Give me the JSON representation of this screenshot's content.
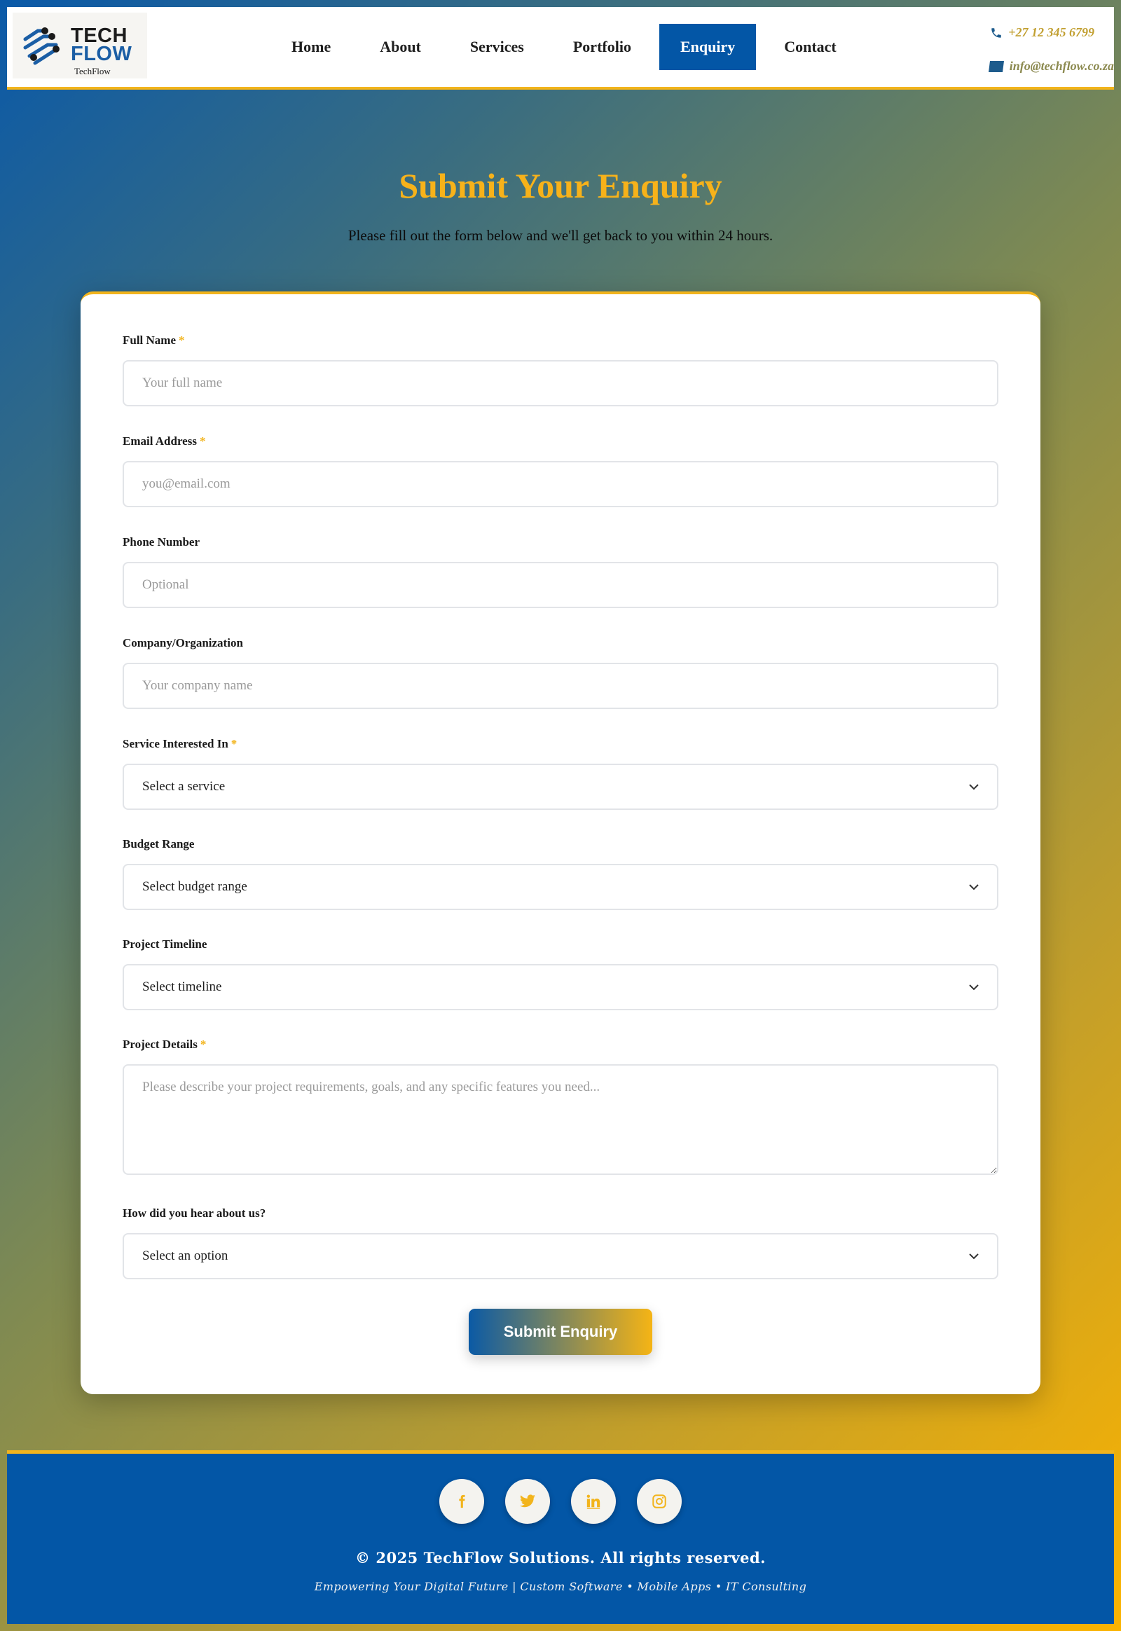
{
  "brand": {
    "logo_line1": "TECH",
    "logo_line2": "FLOW",
    "logo_sub": "TechFlow",
    "accent": "#f2b41c",
    "primary": "#0356a6"
  },
  "nav": {
    "items": [
      {
        "label": "Home",
        "active": false
      },
      {
        "label": "About",
        "active": false
      },
      {
        "label": "Services",
        "active": false
      },
      {
        "label": "Portfolio",
        "active": false
      },
      {
        "label": "Enquiry",
        "active": true
      },
      {
        "label": "Contact",
        "active": false
      }
    ]
  },
  "contact": {
    "phone": "+27 12 345 6799",
    "phone_icon": "phone-icon",
    "email": "info@techflow.co.za",
    "email_icon": "envelope-icon"
  },
  "hero": {
    "title": "Submit Your Enquiry",
    "subtitle": "Please fill out the form below and we'll get back to you within 24 hours."
  },
  "form": {
    "full_name": {
      "label": "Full Name",
      "required": "*",
      "placeholder": "Your full name",
      "value": ""
    },
    "email": {
      "label": "Email Address",
      "required": "*",
      "placeholder": "you@email.com",
      "value": ""
    },
    "phone": {
      "label": "Phone Number",
      "placeholder": "Optional",
      "value": ""
    },
    "company": {
      "label": "Company/Organization",
      "placeholder": "Your company name",
      "value": ""
    },
    "service": {
      "label": "Service Interested In",
      "required": "*",
      "selected": "Select a service"
    },
    "budget": {
      "label": "Budget Range",
      "selected": "Select budget range"
    },
    "timeline": {
      "label": "Project Timeline",
      "selected": "Select timeline"
    },
    "details": {
      "label": "Project Details",
      "required": "*",
      "placeholder": "Please describe your project requirements, goals, and any specific features you need...",
      "value": ""
    },
    "source": {
      "label": "How did you hear about us?",
      "selected": "Select an option"
    },
    "submit_label": "Submit Enquiry"
  },
  "footer": {
    "socials": [
      "facebook-icon",
      "twitter-icon",
      "linkedin-icon",
      "instagram-icon"
    ],
    "copyright": "© 2025 TechFlow Solutions. All rights reserved.",
    "tagline": "Empowering Your Digital Future | Custom Software • Mobile Apps • IT Consulting"
  }
}
